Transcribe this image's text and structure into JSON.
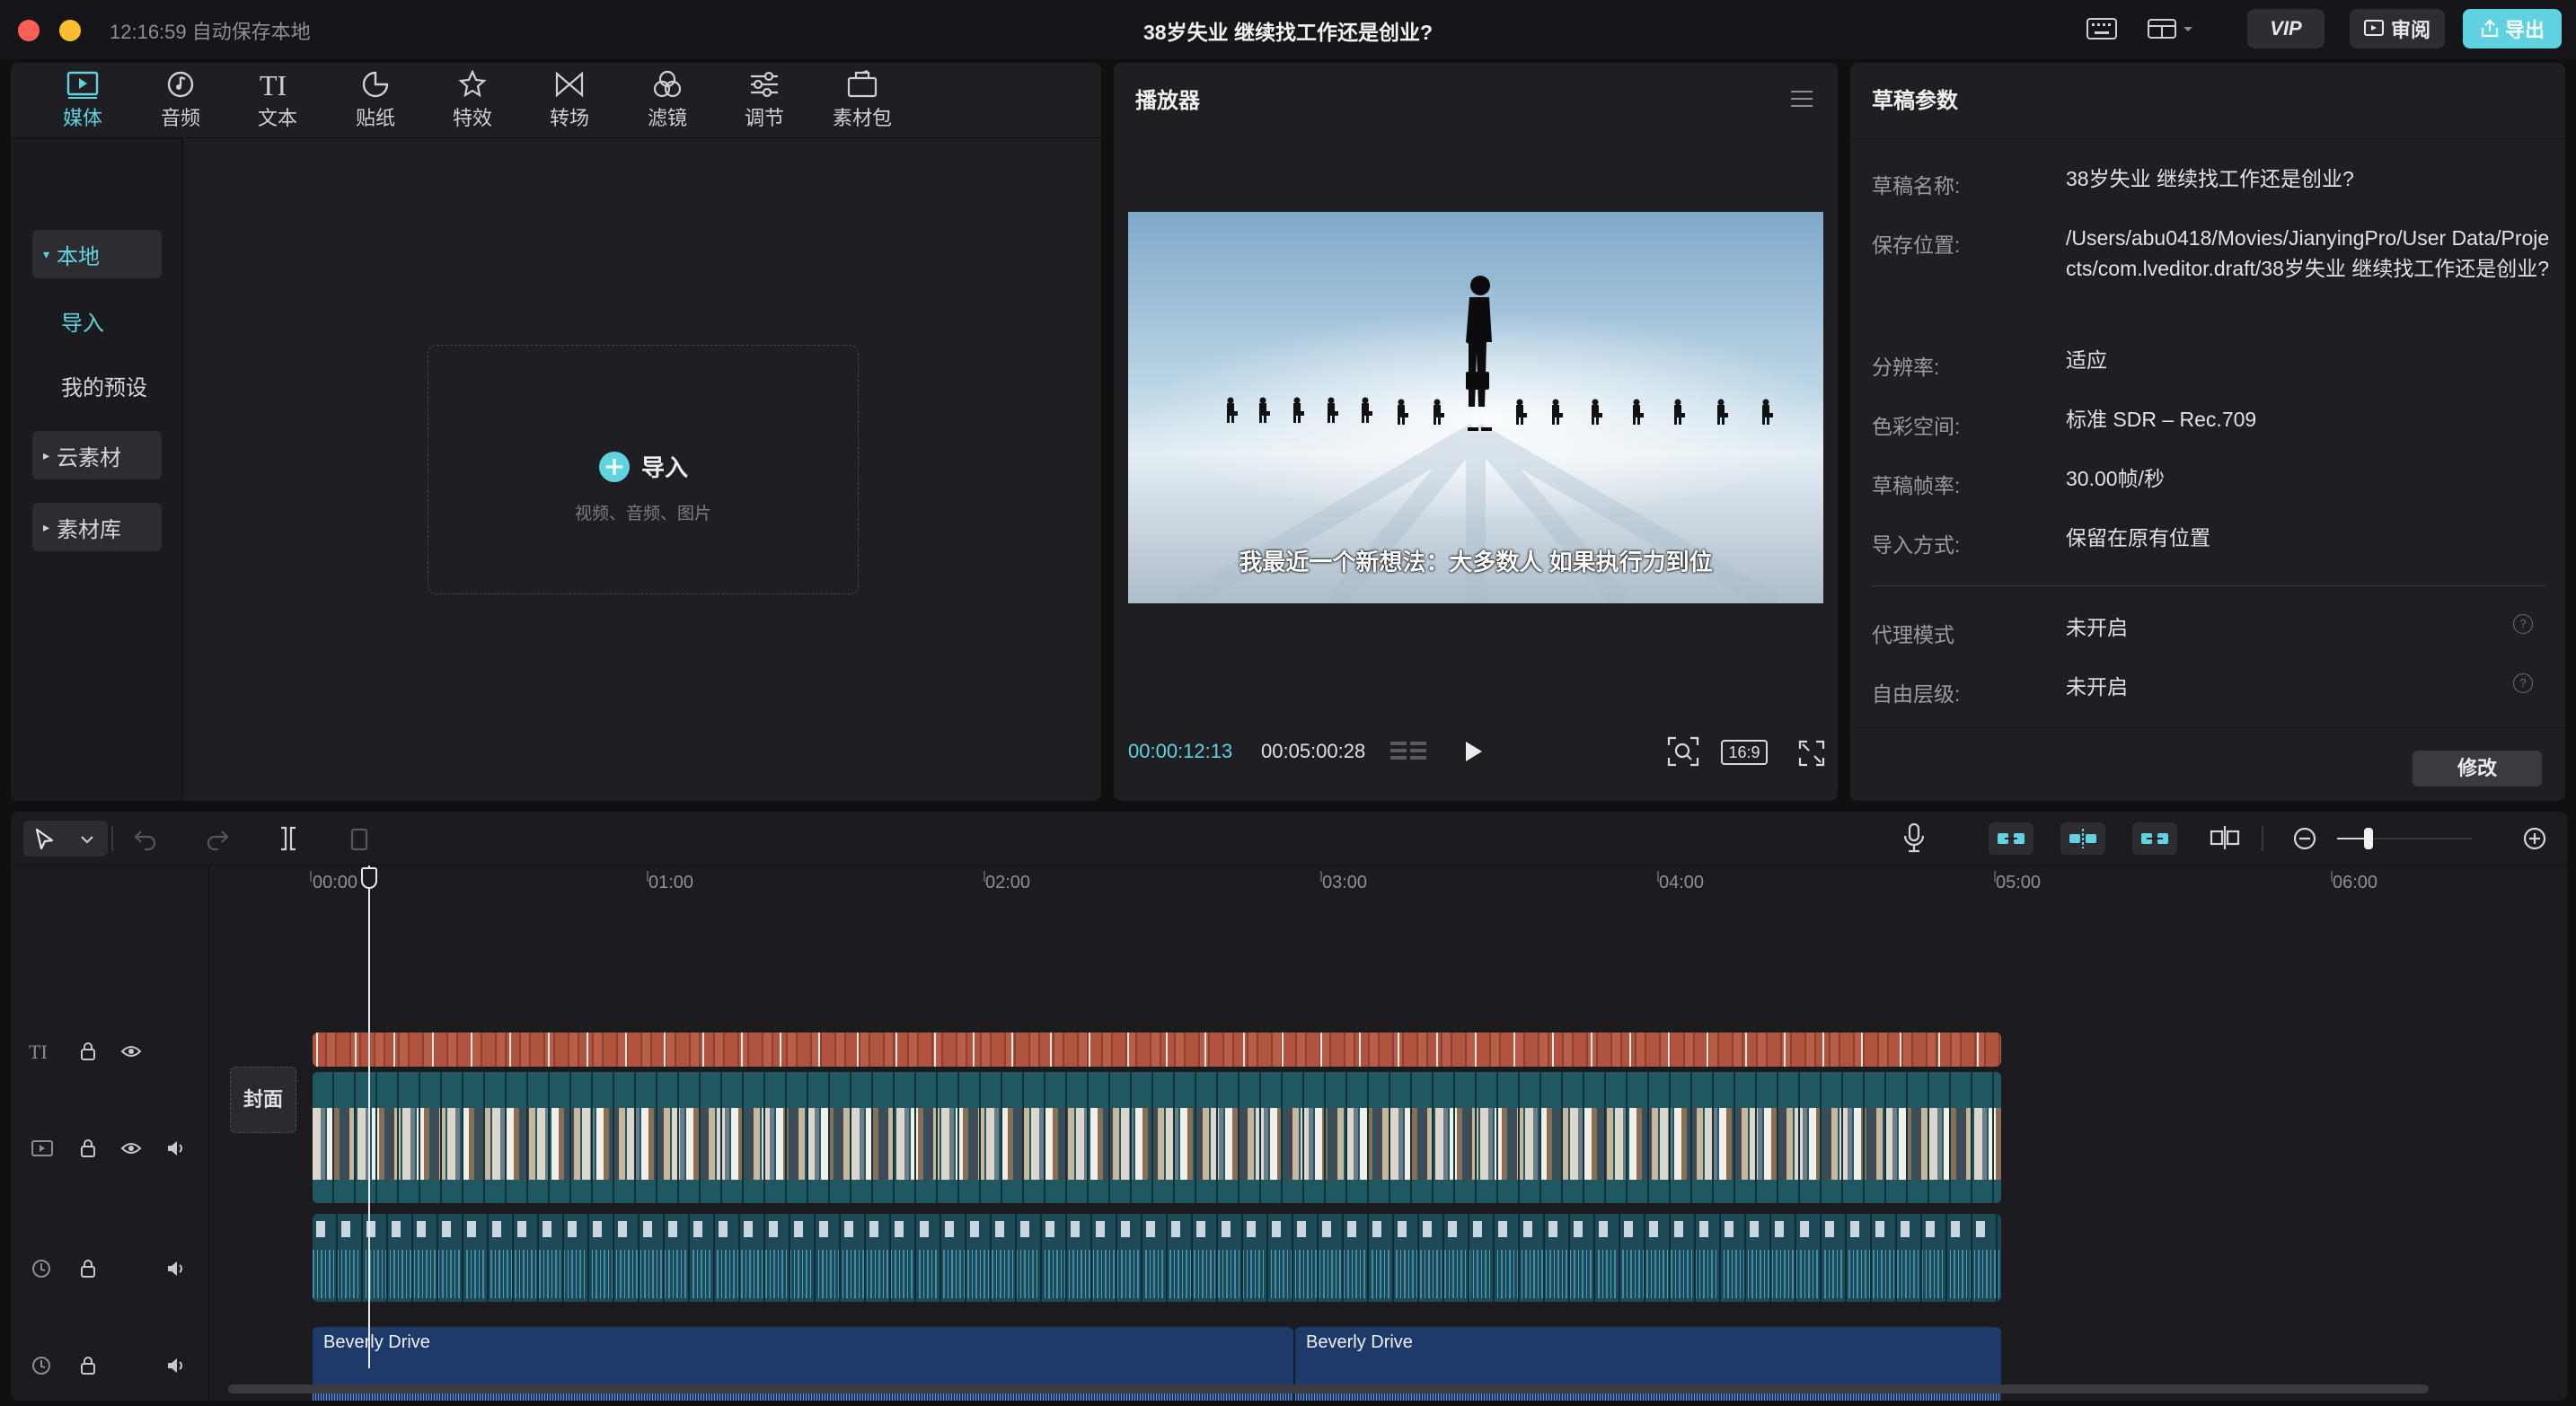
{
  "titlebar": {
    "time_label": "12:16:59 自动保存本地",
    "project_title": "38岁失业 继续找工作还是创业?",
    "vip_label": "VIP",
    "review_label": "审阅",
    "export_label": "导出"
  },
  "media_tabs": [
    {
      "label": "媒体",
      "icon": "media-icon"
    },
    {
      "label": "音频",
      "icon": "audio-icon"
    },
    {
      "label": "文本",
      "icon": "text-icon"
    },
    {
      "label": "贴纸",
      "icon": "sticker-icon"
    },
    {
      "label": "特效",
      "icon": "effects-icon"
    },
    {
      "label": "转场",
      "icon": "transition-icon"
    },
    {
      "label": "滤镜",
      "icon": "filter-icon"
    },
    {
      "label": "调节",
      "icon": "adjust-icon"
    },
    {
      "label": "素材包",
      "icon": "package-icon"
    }
  ],
  "media_sidebar": {
    "local": "本地",
    "import": "导入",
    "presets": "我的预设",
    "cloud": "云素材",
    "library": "素材库"
  },
  "import_box": {
    "label": "导入",
    "hint": "视频、音频、图片"
  },
  "player": {
    "title": "播放器",
    "subtitle": "我最近一个新想法：大多数人 如果执行力到位",
    "current_time": "00:00:12:13",
    "total_time": "00:05:00:28",
    "aspect_label": "16:9"
  },
  "draft_params": {
    "title": "草稿参数",
    "rows": [
      {
        "label": "草稿名称:",
        "value": "38岁失业 继续找工作还是创业?"
      },
      {
        "label": "保存位置:",
        "value": "/Users/abu0418/Movies/JianyingPro/User Data/Projects/com.lveditor.draft/38岁失业 继续找工作还是创业?"
      },
      {
        "label": "分辨率:",
        "value": "适应"
      },
      {
        "label": "色彩空间:",
        "value": "标准 SDR – Rec.709"
      },
      {
        "label": "草稿帧率:",
        "value": "30.00帧/秒"
      },
      {
        "label": "导入方式:",
        "value": "保留在原有位置"
      },
      {
        "label": "代理模式",
        "value": "未开启"
      },
      {
        "label": "自由层级:",
        "value": "未开启"
      }
    ],
    "modify_label": "修改"
  },
  "timeline": {
    "ruler": [
      "00:00",
      "01:00",
      "02:00",
      "03:00",
      "04:00",
      "05:00",
      "06:00"
    ],
    "cover_label": "封面",
    "music_clips": [
      {
        "label": "Beverly Drive"
      },
      {
        "label": "Beverly Drive"
      }
    ]
  },
  "colors": {
    "accent": "#5fd4e0",
    "text_clip": "#b0533f",
    "video_clip": "#1f5860",
    "audio_clip": "#1e4a58",
    "music_clip": "#1d3a6a"
  }
}
